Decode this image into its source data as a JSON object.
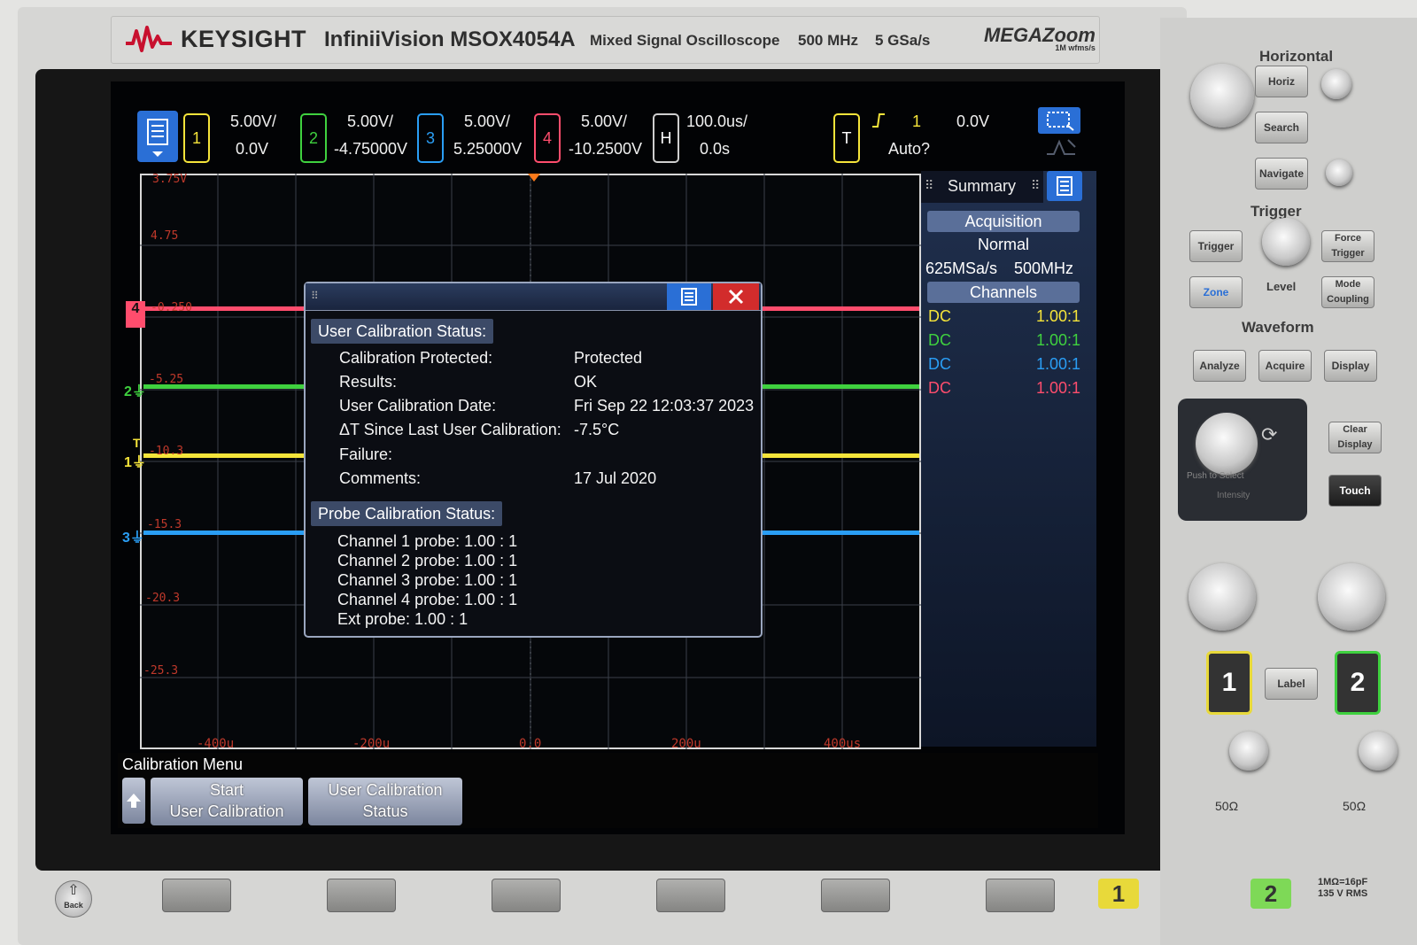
{
  "brand": {
    "name_a": "KEY",
    "name_b": "SIGHT",
    "model": "InfiniiVision MSOX4054A",
    "description": "Mixed Signal Oscilloscope",
    "bandwidth": "500 MHz",
    "sample_rate": "5 GSa/s",
    "megazoom": "MEGAZoom",
    "megazoom_sub": "1M wfms/s"
  },
  "colors": {
    "ch1": "#f5e43a",
    "ch2": "#3fd13f",
    "ch3": "#2a9ef5",
    "ch4": "#ff4d6d",
    "accent": "#2a6fd6"
  },
  "channels": [
    {
      "num": "1",
      "scale": "5.00V/",
      "offset": "0.0V"
    },
    {
      "num": "2",
      "scale": "5.00V/",
      "offset": "-4.75000V"
    },
    {
      "num": "3",
      "scale": "5.00V/",
      "offset": "5.25000V"
    },
    {
      "num": "4",
      "scale": "5.00V/",
      "offset": "-10.2500V"
    }
  ],
  "horizontal": {
    "label": "H",
    "scale": "100.0us/",
    "position": "0.0s"
  },
  "trigger": {
    "label": "T",
    "source": "1",
    "level": "0.0V",
    "mode": "Auto?"
  },
  "grid": {
    "y_labels": [
      "3.75V",
      "4.75",
      "-0.250",
      "-5.25",
      "-10.3",
      "-15.3",
      "-20.3",
      "-25.3"
    ],
    "x_labels": [
      "-400u",
      "-200u",
      "0.0",
      "200u",
      "400us"
    ]
  },
  "summary": {
    "title": "Summary",
    "acquisition_header": "Acquisition",
    "mode": "Normal",
    "rate": "625MSa/s",
    "bw": "500MHz",
    "channels_header": "Channels",
    "rows": [
      {
        "coupling": "DC",
        "probe": "1.00:1"
      },
      {
        "coupling": "DC",
        "probe": "1.00:1"
      },
      {
        "coupling": "DC",
        "probe": "1.00:1"
      },
      {
        "coupling": "DC",
        "probe": "1.00:1"
      }
    ]
  },
  "dialog": {
    "user_cal_header": "User Calibration Status:",
    "user_cal": [
      {
        "label": "Calibration Protected:",
        "value": "Protected"
      },
      {
        "label": "Results:",
        "value": "OK"
      },
      {
        "label": "User Calibration Date:",
        "value": "Fri Sep 22 12:03:37 2023"
      },
      {
        "label": "ΔT Since Last User Calibration:",
        "value": "-7.5°C"
      },
      {
        "label": "Failure:",
        "value": ""
      },
      {
        "label": "Comments:",
        "value": "17 Jul 2020"
      }
    ],
    "probe_cal_header": "Probe Calibration Status:",
    "probe_cal": [
      "Channel 1 probe: 1.00 : 1",
      "Channel 2 probe: 1.00 : 1",
      "Channel 3 probe: 1.00 : 1",
      "Channel 4 probe: 1.00 : 1",
      "Ext probe: 1.00 : 1"
    ]
  },
  "softkeys": {
    "menu_title": "Calibration Menu",
    "start_line1": "Start",
    "start_line2": "User Calibration",
    "status_line1": "User Calibration",
    "status_line2": "Status"
  },
  "panel": {
    "horizontal": "Horizontal",
    "horiz_btn": "Horiz",
    "search_btn": "Search",
    "navigate_btn": "Navigate",
    "trigger": "Trigger",
    "trigger_btn": "Trigger",
    "force_trigger_btn": "Force Trigger",
    "zone_btn": "Zone",
    "level": "Level",
    "mode_coupling_btn": "Mode Coupling",
    "waveform": "Waveform",
    "analyze_btn": "Analyze",
    "acquire_btn": "Acquire",
    "display_btn": "Display",
    "push_to_select": "Push to Select",
    "intensity": "Intensity",
    "clear_display_btn": "Clear Display",
    "touch_btn": "Touch",
    "label_btn": "Label",
    "ch1_btn": "1",
    "ch2_btn": "2",
    "ohm1": "50Ω",
    "ohm2": "50Ω",
    "bottom_ch1": "1",
    "bottom_ch2": "2",
    "input_spec": "1MΩ=16pF 135 V RMS",
    "back": "Back"
  }
}
